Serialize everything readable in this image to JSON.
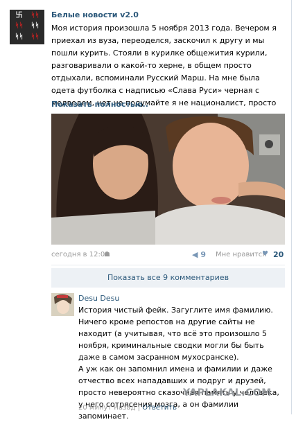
{
  "post": {
    "author": "Белые новости v2.0",
    "text": "Моя история произошла 5 ноября 2013 года. Вечером я приехал из вуза, переоделся, заскочил к другу и мы пошли курить. Стояли в курилке общежития курили, разговаривали о какой-то херне, в общем просто отдыхали, вспоминали Русский Марш. На мне была одета футболка с надписью «Слава Руси» черная с медведем, нет не подумайте я не националист, просто нравится мне она очень.",
    "show_more": "Показать полностью..",
    "time": "сегодня в 12:01",
    "repost_count": "9",
    "likes_label": "Мне нравится",
    "likes_count": "20"
  },
  "comments": {
    "show_all": "Показать все 9 комментариев",
    "items": [
      {
        "author": "Desu Desu",
        "text": "История чистый фейк. Загуглите имя фамилию. Ничего кроме репостов на другие сайты не находит (а учитывая, что всё это произошло 5 ноября, криминальные сводки могли бы быть даже в самом засранном мухосранске).\nА уж как он запомнил имена и фамилии и даже отчество всех нападавших и подруг и друзей, просто невероятно сказочная память у человека, у него сотрясения мозга, а он фамилии запоминает.",
        "time": "20 минут назад",
        "separator": "|",
        "reply": "Ответить"
      }
    ]
  },
  "watermark": "YAPLAKAL.COM"
}
